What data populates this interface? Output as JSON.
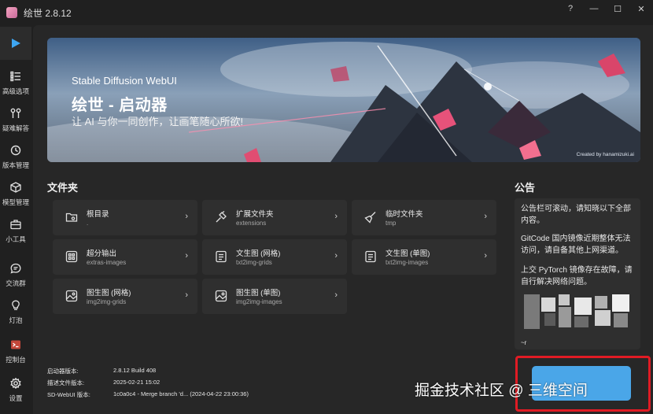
{
  "window": {
    "title": "绘世 2.8.12",
    "controls": [
      "?",
      "—",
      "☐",
      "✕"
    ]
  },
  "sidebar": {
    "items": [
      {
        "label": "高级选项",
        "icon": "list-icon"
      },
      {
        "label": "疑难解答",
        "icon": "wrench-icon"
      },
      {
        "label": "版本管理",
        "icon": "history-icon"
      },
      {
        "label": "模型管理",
        "icon": "cube-icon"
      },
      {
        "label": "小工具",
        "icon": "toolbox-icon"
      },
      {
        "label": "交流群",
        "icon": "chat-icon"
      },
      {
        "label": "灯泡",
        "icon": "bulb-icon"
      },
      {
        "label": "控制台",
        "icon": "console-icon"
      },
      {
        "label": "设置",
        "icon": "gear-icon"
      }
    ]
  },
  "banner": {
    "subtitle": "Stable Diffusion WebUI",
    "title": "绘世 - 启动器",
    "slogan": "让 AI 与你一同创作，让画笔随心所欲!",
    "credit": "Created by hanamizuki.ai"
  },
  "folders": {
    "heading": "文件夹",
    "items": [
      {
        "name": "根目录",
        "path": ".",
        "icon": "folder-icon"
      },
      {
        "name": "扩展文件夹",
        "path": "extensions",
        "icon": "plug-icon"
      },
      {
        "name": "临时文件夹",
        "path": "tmp",
        "icon": "broom-icon"
      },
      {
        "name": "超分输出",
        "path": "extras-images",
        "icon": "grid-icon"
      },
      {
        "name": "文生图 (网格)",
        "path": "txt2img-grids",
        "icon": "doc-icon"
      },
      {
        "name": "文生图 (单图)",
        "path": "txt2img-images",
        "icon": "doc-icon"
      },
      {
        "name": "图生图 (网格)",
        "path": "img2img-grids",
        "icon": "image-icon"
      },
      {
        "name": "图生图 (单图)",
        "path": "img2img-images",
        "icon": "image-icon"
      }
    ]
  },
  "notice": {
    "heading": "公告",
    "p1": "公告栏可滚动，请知晓以下全部内容。",
    "p2": "GitCode 国内镜像近期整体无法访问，请自备其他上网渠道。",
    "p3": "上交 PyTorch 镜像存在故障，请自行解决网络问题。",
    "p4": "~r"
  },
  "info": {
    "launcher_label": "启动器版本:",
    "launcher_value": "2.8.12 Build 408",
    "desc_label": "描述文件版本:",
    "desc_value": "2025-02-21 15:02",
    "webui_label": "SD-WebUI 版本:",
    "webui_value": "1c0a0c4 - Merge branch 'd... (2024-04-22 23:00:36)"
  },
  "watermark": "掘金技术社区 @ 三维空间",
  "colors": {
    "accent": "#4aa6e8",
    "highlight": "#e01b24",
    "play": "#3ea6f2"
  }
}
